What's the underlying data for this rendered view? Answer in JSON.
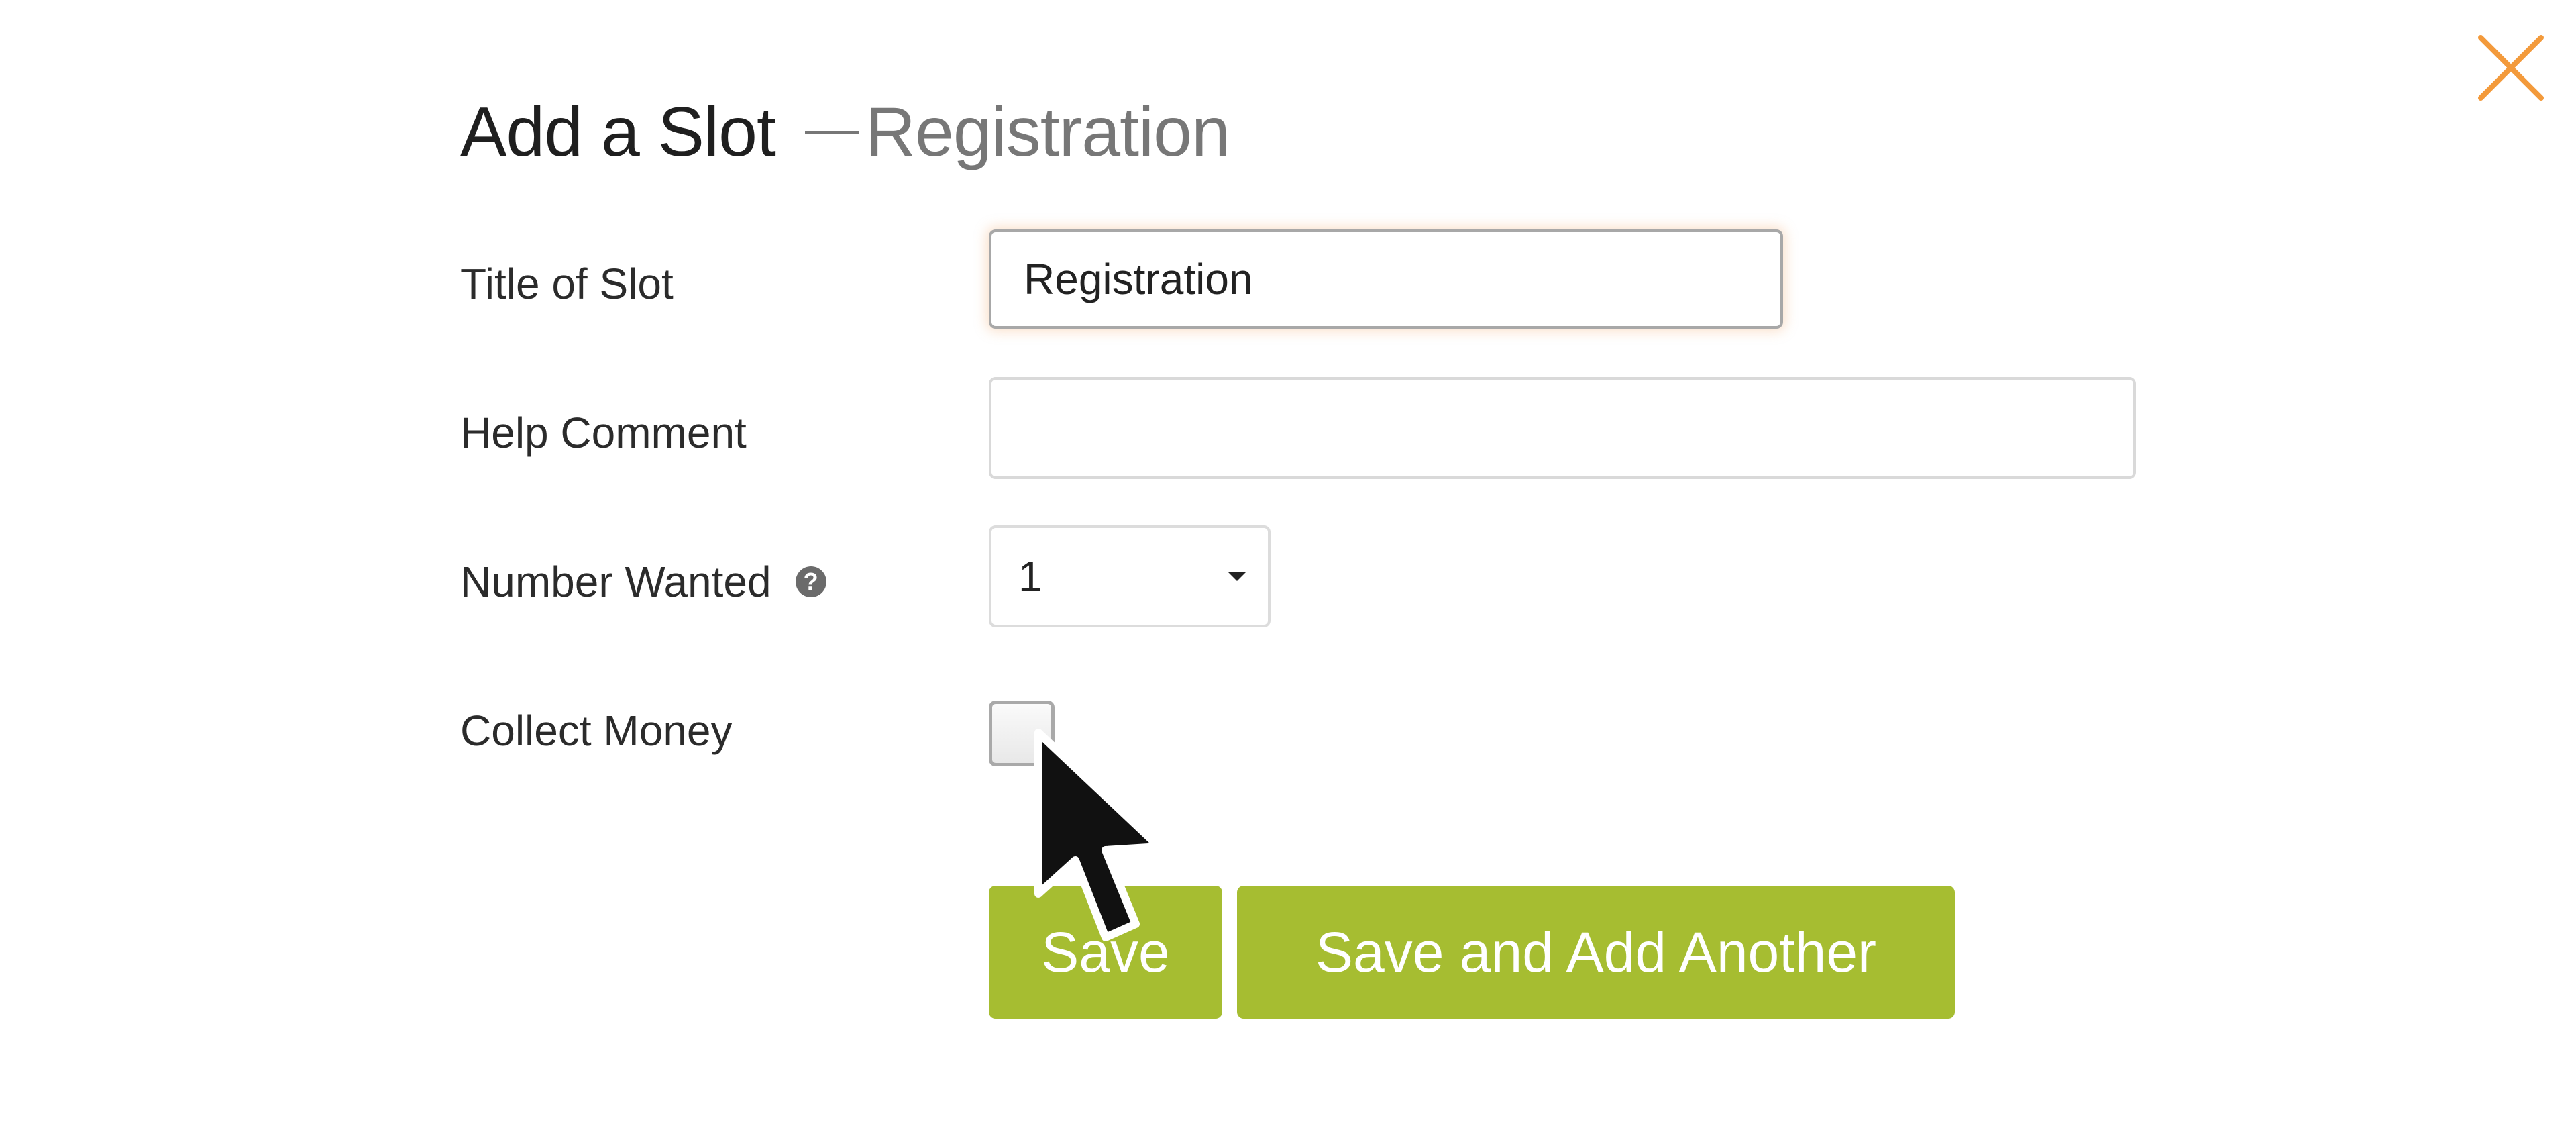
{
  "dialog": {
    "title": "Add a Slot",
    "subtitle": "Registration",
    "close_icon": "close-icon",
    "accent_color": "#f39a3b"
  },
  "form": {
    "title_of_slot": {
      "label": "Title of Slot",
      "value": "Registration"
    },
    "help_comment": {
      "label": "Help Comment",
      "value": ""
    },
    "number_wanted": {
      "label": "Number Wanted",
      "help_icon": "question-circle-icon",
      "selected": "1"
    },
    "collect_money": {
      "label": "Collect Money",
      "checked": false
    }
  },
  "buttons": {
    "save_label": "Save",
    "save_add_label": "Save and Add Another",
    "color": "#a6bd31"
  }
}
